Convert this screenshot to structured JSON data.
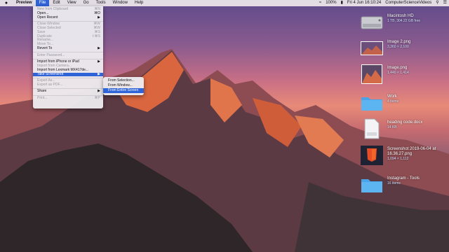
{
  "menubar": {
    "app_name": "Preview",
    "menus": [
      "File",
      "Edit",
      "View",
      "Go",
      "Tools",
      "Window",
      "Help"
    ],
    "battery": "100%",
    "datetime": "Fri 4 Jun  16:10:24",
    "user": "ComputerScienceVideos"
  },
  "file_menu": {
    "items": [
      {
        "label": "New from Clipboard",
        "shortcut": "⌘N",
        "disabled": true
      },
      {
        "label": "Open...",
        "shortcut": "⌘O",
        "disabled": false
      },
      {
        "label": "Open Recent",
        "shortcut": "▶",
        "disabled": false
      },
      {
        "label": "Close Window",
        "shortcut": "⌘W",
        "disabled": true
      },
      {
        "label": "Close Selected",
        "shortcut": "⌘W",
        "disabled": true
      },
      {
        "label": "Save",
        "shortcut": "⌘S",
        "disabled": true
      },
      {
        "label": "Duplicate",
        "shortcut": "⇧⌘S",
        "disabled": true
      },
      {
        "label": "Rename...",
        "shortcut": "",
        "disabled": true
      },
      {
        "label": "Move To...",
        "shortcut": "",
        "disabled": true
      },
      {
        "label": "Revert To",
        "shortcut": "▶",
        "disabled": false
      },
      {
        "label": "Enter Password...",
        "shortcut": "",
        "disabled": true
      },
      {
        "label": "Import from iPhone or iPad",
        "shortcut": "▶",
        "disabled": false
      },
      {
        "label": "Import from Camera...",
        "shortcut": "",
        "disabled": true
      },
      {
        "label": "Import from Lexmark MX417de...",
        "shortcut": "",
        "disabled": false
      },
      {
        "label": "Take Screenshot",
        "shortcut": "▶",
        "disabled": false
      },
      {
        "label": "Export As...",
        "shortcut": "",
        "disabled": true
      },
      {
        "label": "Export as PDF...",
        "shortcut": "",
        "disabled": true
      },
      {
        "label": "Share",
        "shortcut": "▶",
        "disabled": false
      },
      {
        "label": "Print...",
        "shortcut": "⌘P",
        "disabled": true
      }
    ]
  },
  "screenshot_submenu": {
    "items": [
      "From Selection...",
      "From Window...",
      "From Entire Screen"
    ],
    "highlighted": "From Entire Screen"
  },
  "desktop_icons": [
    {
      "name": "Macintosh HD",
      "detail": "1 TB, 304.22 GB free",
      "kind": "drive-icon"
    },
    {
      "name": "Image 2.png",
      "detail": "3,360 × 2,100",
      "kind": "image-icon"
    },
    {
      "name": "Image.png",
      "detail": "1,440 × 1,414",
      "kind": "image-icon"
    },
    {
      "name": "Work",
      "detail": "4 items",
      "kind": "folder-icon"
    },
    {
      "name": "heading code.docx",
      "detail": "14 KB",
      "kind": "document-icon"
    },
    {
      "name": "Screenshot 2019-06-04 at 16.36.27.png",
      "detail": "1,094 × 1,112",
      "kind": "html5-image-icon"
    },
    {
      "name": "Instagram - Tools",
      "detail": "16 items",
      "kind": "folder-icon"
    }
  ],
  "colors": {
    "menu_highlight": "#2f64d8",
    "folder": "#4aa3e8"
  }
}
